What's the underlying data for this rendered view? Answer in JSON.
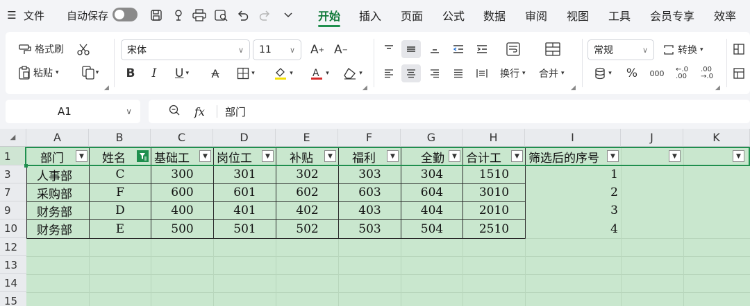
{
  "menubar": {
    "hamburger_icon": "menu-icon",
    "file_label": "文件",
    "autosave_label": "自动保存",
    "tabs": [
      "开始",
      "插入",
      "页面",
      "公式",
      "数据",
      "审阅",
      "视图",
      "工具",
      "会员专享",
      "效率"
    ],
    "active_tab": "开始",
    "accent_color": "#1f8f4e"
  },
  "ribbon": {
    "format_painter_label": "格式刷",
    "paste_label": "粘贴",
    "font_name": "宋体",
    "font_size": "11",
    "wrap_label": "换行",
    "merge_label": "合并",
    "number_format": "常规",
    "convert_label": "转换",
    "percent_symbol": "%",
    "thousands_symbol": "000"
  },
  "formula_bar": {
    "cell_ref": "A1",
    "fx_label": "fx",
    "content": "部门"
  },
  "sheet": {
    "column_letters": [
      "A",
      "B",
      "C",
      "D",
      "E",
      "F",
      "G",
      "H",
      "I",
      "J",
      "K"
    ],
    "row_numbers": [
      "1",
      "3",
      "7",
      "9",
      "10",
      "12",
      "13",
      "14",
      "15"
    ],
    "headers": [
      "部门",
      "姓名",
      "基础工",
      "岗位工",
      "补贴",
      "福利",
      "全勤",
      "合计工",
      "筛选后的序号",
      "",
      ""
    ],
    "rows": [
      [
        "人事部",
        "C",
        "300",
        "301",
        "302",
        "303",
        "304",
        "1510",
        "1"
      ],
      [
        "采购部",
        "F",
        "600",
        "601",
        "602",
        "603",
        "604",
        "3010",
        "2"
      ],
      [
        "财务部",
        "D",
        "400",
        "401",
        "402",
        "403",
        "404",
        "2010",
        "3"
      ],
      [
        "财务部",
        "E",
        "500",
        "501",
        "502",
        "503",
        "504",
        "2510",
        "4"
      ]
    ],
    "active_filter_column": "B",
    "fill_color": "#c9e7ce"
  }
}
